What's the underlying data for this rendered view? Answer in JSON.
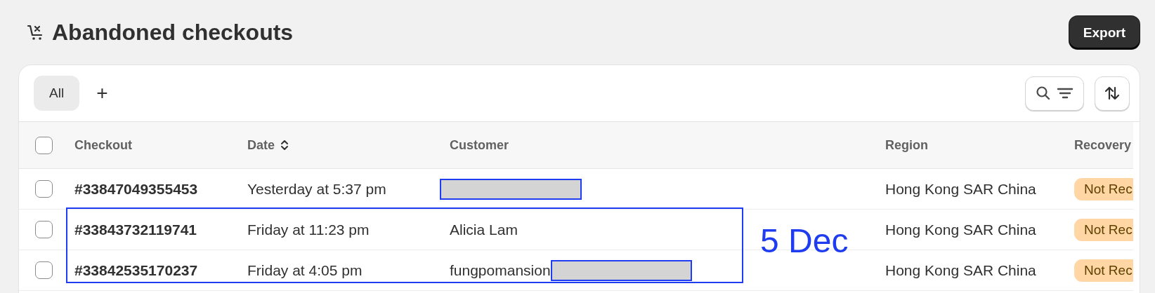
{
  "page": {
    "title": "Abandoned checkouts"
  },
  "export_button": {
    "label": "Export"
  },
  "tabs": [
    {
      "label": "All",
      "selected": true
    }
  ],
  "add_tab": {
    "label": "+"
  },
  "table": {
    "select_all": {
      "checked": false
    },
    "columns": [
      {
        "label": "Checkout",
        "sortable": false
      },
      {
        "label": "Date",
        "sortable": true
      },
      {
        "label": "Customer",
        "sortable": false
      },
      {
        "label": "Region",
        "sortable": false
      },
      {
        "label": "Recovery",
        "sortable": false
      }
    ],
    "rows": [
      {
        "checked": false,
        "checkout": "#33847049355453",
        "date": "Yesterday at 5:37 pm",
        "customer_redacted": true,
        "region": "Hong Kong SAR China",
        "recovery": {
          "text": "Not Rec",
          "kind": "not_recovered"
        }
      },
      {
        "checked": false,
        "checkout": "#33843732119741",
        "date": "Friday at 11:23 pm",
        "customer": "Alicia Lam",
        "customer_redacted": false,
        "region": "Hong Kong SAR China",
        "recovery": {
          "text": "Not Rec",
          "kind": "not_recovered"
        }
      },
      {
        "checked": false,
        "checkout": "#33842535170237",
        "date": "Friday at 4:05 pm",
        "customer": "fungpomansion",
        "customer_redacted": true,
        "region": "Hong Kong SAR China",
        "recovery": {
          "text": "Not Rec",
          "kind": "not_recovered"
        }
      }
    ]
  },
  "annotation": {
    "text": "5 Dec"
  }
}
